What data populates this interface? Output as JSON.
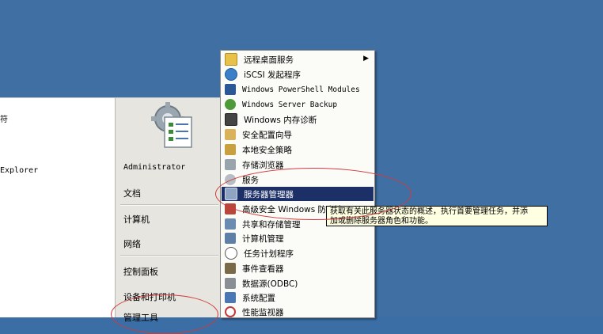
{
  "left_pane": {
    "items": [
      "符",
      "Explorer"
    ]
  },
  "right_pane": {
    "links": [
      "Administrator",
      "文档",
      "计算机",
      "网络",
      "控制面板",
      "设备和打印机",
      "管理工具"
    ]
  },
  "submenu": {
    "items": [
      {
        "label": "远程桌面服务",
        "icon": "folder-icon",
        "has_submenu": true,
        "arrow": "▶"
      },
      {
        "label": "iSCSI 发起程序",
        "icon": "globe-icon"
      },
      {
        "label": "Windows PowerShell Modules",
        "icon": "powershell-icon"
      },
      {
        "label": "Windows Server Backup",
        "icon": "backup-icon"
      },
      {
        "label": "Windows 内存诊断",
        "icon": "memory-diagnostic-icon"
      },
      {
        "label": "安全配置向导",
        "icon": "security-wizard-icon"
      },
      {
        "label": "本地安全策略",
        "icon": "security-policy-icon"
      },
      {
        "label": "存储浏览器",
        "icon": "storage-icon"
      },
      {
        "label": "服务",
        "icon": "services-gear-icon"
      },
      {
        "label": "服务器管理器",
        "icon": "server-manager-icon",
        "highlighted": true
      },
      {
        "label": "高级安全 Windows 防火墙",
        "icon": "firewall-icon"
      },
      {
        "label": "共享和存储管理",
        "icon": "share-storage-icon"
      },
      {
        "label": "计算机管理",
        "icon": "computer-management-icon"
      },
      {
        "label": "任务计划程序",
        "icon": "clock-icon"
      },
      {
        "label": "事件查看器",
        "icon": "event-viewer-icon"
      },
      {
        "label": "数据源(ODBC)",
        "icon": "odbc-icon"
      },
      {
        "label": "系统配置",
        "icon": "system-config-icon"
      },
      {
        "label": "性能监视器",
        "icon": "performance-monitor-icon"
      }
    ]
  },
  "tooltip": {
    "line1": "获取有关此服务器状态的概述，执行首要管理任务，并添",
    "line2": "加或删除服务器角色和功能。"
  },
  "colors": {
    "desktop": "#3f6fa3",
    "highlight": "#1c2f66",
    "tooltip_bg": "#ffffe1",
    "annotation": "#d23b3b"
  }
}
